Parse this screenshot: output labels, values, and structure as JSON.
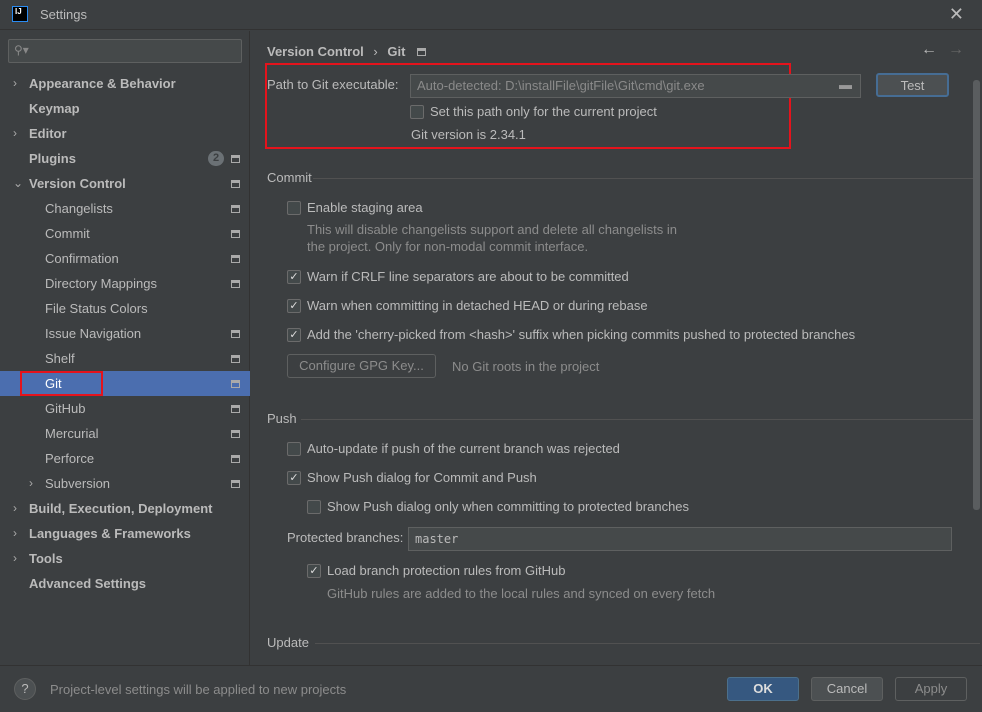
{
  "window": {
    "title": "Settings",
    "logo": "IJ",
    "close": "✕"
  },
  "sidebar": {
    "search_icon": "⚲▾",
    "items": [
      {
        "label": "Appearance & Behavior"
      },
      {
        "label": "Keymap"
      },
      {
        "label": "Editor"
      },
      {
        "label": "Plugins",
        "badge": "2"
      },
      {
        "label": "Version Control"
      },
      {
        "label": "Changelists"
      },
      {
        "label": "Commit"
      },
      {
        "label": "Confirmation"
      },
      {
        "label": "Directory Mappings"
      },
      {
        "label": "File Status Colors"
      },
      {
        "label": "Issue Navigation"
      },
      {
        "label": "Shelf"
      },
      {
        "label": "Git"
      },
      {
        "label": "GitHub"
      },
      {
        "label": "Mercurial"
      },
      {
        "label": "Perforce"
      },
      {
        "label": "Subversion"
      },
      {
        "label": "Build, Execution, Deployment"
      },
      {
        "label": "Languages & Frameworks"
      },
      {
        "label": "Tools"
      },
      {
        "label": "Advanced Settings"
      }
    ]
  },
  "breadcrumb": {
    "parent": "Version Control",
    "sep": "›",
    "current": "Git"
  },
  "nav": {
    "back": "←",
    "forward": "→"
  },
  "git": {
    "path_label": "Path to Git executable:",
    "path_placeholder": "Auto-detected: D:\\installFile\\gitFile\\Git\\cmd\\git.exe",
    "test": "Test",
    "project_only": "Set this path only for the current project",
    "version": "Git version is 2.34.1"
  },
  "commit": {
    "title": "Commit",
    "staging": "Enable staging area",
    "staging_hint1": "This will disable changelists support and delete all changelists in",
    "staging_hint2": "the project. Only for non-modal commit interface.",
    "crlf": "Warn if CRLF line separators are about to be committed",
    "detached": "Warn when committing in detached HEAD or during rebase",
    "cherry": "Add the 'cherry-picked from <hash>' suffix when picking commits pushed to protected branches",
    "gpg": "Configure GPG Key...",
    "no_roots": "No Git roots in the project"
  },
  "push": {
    "title": "Push",
    "auto_update": "Auto-update if push of the current branch was rejected",
    "show_dialog": "Show Push dialog for Commit and Push",
    "protected_only": "Show Push dialog only when committing to protected branches",
    "protected_label": "Protected branches:",
    "protected_value": "master",
    "load_rules": "Load branch protection rules from GitHub",
    "rules_hint": "GitHub rules are added to the local rules and synced on every fetch"
  },
  "update": {
    "title": "Update"
  },
  "footer": {
    "help": "?",
    "note": "Project-level settings will be applied to new projects",
    "ok": "OK",
    "cancel": "Cancel",
    "apply": "Apply"
  }
}
